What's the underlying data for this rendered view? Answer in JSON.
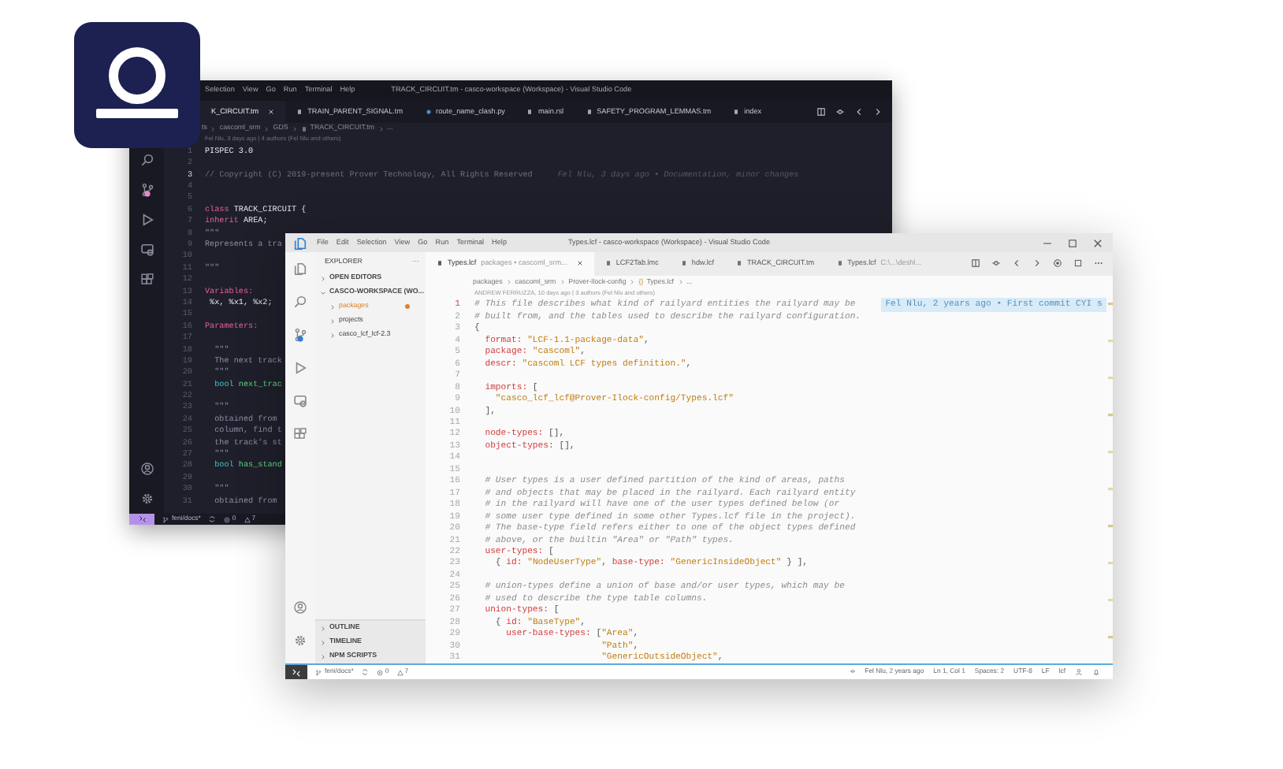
{
  "dark_window": {
    "menu": [
      "Selection",
      "View",
      "Go",
      "Run",
      "Terminal",
      "Help"
    ],
    "title": "TRACK_CIRCUIT.tm - casco-workspace (Workspace) - Visual Studio Code",
    "tabs": [
      {
        "label": "K_CIRCUIT.tm",
        "selected": true,
        "kind": "none"
      },
      {
        "label": "TRAIN_PARENT_SIGNAL.tm",
        "selected": false,
        "kind": "file"
      },
      {
        "label": "route_name_clash.py",
        "selected": false,
        "kind": "python"
      },
      {
        "label": "main.rsl",
        "selected": false,
        "kind": "file"
      },
      {
        "label": "SAFETY_PROGRAM_LEMMAS.tm",
        "selected": false,
        "kind": "file"
      },
      {
        "label": "index",
        "selected": false,
        "kind": "file"
      }
    ],
    "breadcrumb": [
      {
        "label": "ts",
        "kind": "none"
      },
      {
        "label": "cascoml_srm",
        "kind": "none"
      },
      {
        "label": "GDS",
        "kind": "none"
      },
      {
        "label": "TRACK_CIRCUIT.tm",
        "kind": "file"
      },
      {
        "label": "...",
        "kind": "none"
      }
    ],
    "blame_header": "Fel Nlu, 3 days ago | 4 authors (Fel Nlu and others)",
    "lines": [
      {
        "number": "1",
        "current": false,
        "segments": [
          {
            "text": "PISPEC 3.0",
            "kind": "ident"
          }
        ]
      },
      {
        "number": "2",
        "current": false
      },
      {
        "number": "3",
        "current": true,
        "segments": [
          {
            "text": "// Copyright (C) 2019-present Prover Technology, All Rights Reserved",
            "kind": "comment"
          }
        ],
        "blame": "Fel Nlu, 3 days ago • Documentation, minor changes"
      },
      {
        "number": "4",
        "current": false
      },
      {
        "number": "5",
        "current": false
      },
      {
        "number": "6",
        "current": false,
        "segments": [
          {
            "text": "class ",
            "kind": "kw"
          },
          {
            "text": "TRACK_CIRCUIT {",
            "kind": "ident"
          }
        ]
      },
      {
        "number": "7",
        "current": false,
        "segments": [
          {
            "text": "inherit ",
            "kind": "kw"
          },
          {
            "text": "AREA;",
            "kind": "ident"
          }
        ]
      },
      {
        "number": "8",
        "current": false,
        "segments": [
          {
            "text": "\"\"\"",
            "kind": "doc"
          }
        ]
      },
      {
        "number": "9",
        "current": false,
        "segments": [
          {
            "text": "Represents a tra",
            "kind": "doc"
          }
        ]
      },
      {
        "number": "10",
        "current": false
      },
      {
        "number": "11",
        "current": false,
        "segments": [
          {
            "text": "\"\"\"",
            "kind": "doc"
          }
        ]
      },
      {
        "number": "12",
        "current": false
      },
      {
        "number": "13",
        "current": false,
        "segments": [
          {
            "text": "Variables:",
            "kind": "kw"
          }
        ]
      },
      {
        "number": "14",
        "current": false,
        "segments": [
          {
            "text": " %x, %x1, %x2;",
            "kind": "ident"
          }
        ]
      },
      {
        "number": "15",
        "current": false
      },
      {
        "number": "16",
        "current": false,
        "segments": [
          {
            "text": "Parameters:",
            "kind": "kw"
          }
        ]
      },
      {
        "number": "17",
        "current": false
      },
      {
        "number": "18",
        "current": false,
        "segments": [
          {
            "text": "  \"\"\"",
            "kind": "doc"
          }
        ]
      },
      {
        "number": "19",
        "current": false,
        "segments": [
          {
            "text": "  The next track",
            "kind": "doc"
          }
        ]
      },
      {
        "number": "20",
        "current": false,
        "segments": [
          {
            "text": "  \"\"\"",
            "kind": "doc"
          }
        ]
      },
      {
        "number": "21",
        "current": false,
        "segments": [
          {
            "text": "  bool ",
            "kind": "type"
          },
          {
            "text": "next_trac",
            "kind": "name"
          }
        ]
      },
      {
        "number": "22",
        "current": false
      },
      {
        "number": "23",
        "current": false,
        "segments": [
          {
            "text": "  \"\"\"",
            "kind": "doc"
          }
        ]
      },
      {
        "number": "24",
        "current": false,
        "segments": [
          {
            "text": "  obtained from",
            "kind": "doc"
          }
        ]
      },
      {
        "number": "25",
        "current": false,
        "segments": [
          {
            "text": "  column, find t",
            "kind": "doc"
          }
        ]
      },
      {
        "number": "26",
        "current": false,
        "segments": [
          {
            "text": "  the track's st",
            "kind": "doc"
          }
        ]
      },
      {
        "number": "27",
        "current": false,
        "segments": [
          {
            "text": "  \"\"\"",
            "kind": "doc"
          }
        ]
      },
      {
        "number": "28",
        "current": false,
        "segments": [
          {
            "text": "  bool ",
            "kind": "type"
          },
          {
            "text": "has_stand",
            "kind": "name"
          }
        ]
      },
      {
        "number": "29",
        "current": false
      },
      {
        "number": "30",
        "current": false,
        "segments": [
          {
            "text": "  \"\"\"",
            "kind": "doc"
          }
        ]
      },
      {
        "number": "31",
        "current": false,
        "segments": [
          {
            "text": "  obtained from",
            "kind": "doc"
          }
        ]
      }
    ],
    "status_bar": {
      "branch": "feni/docs*",
      "errors": "0",
      "warnings": "7"
    }
  },
  "light_window": {
    "menu": [
      "File",
      "Edit",
      "Selection",
      "View",
      "Go",
      "Run",
      "Terminal",
      "Help"
    ],
    "title": "Types.lcf - casco-workspace (Workspace) - Visual Studio Code",
    "explorer": {
      "title": "EXPLORER",
      "more": "···",
      "sections": [
        {
          "label": "OPEN EDITORS",
          "expanded": false
        },
        {
          "label": "CASCO-WORKSPACE (WO...",
          "expanded": true,
          "children": [
            {
              "label": "packages",
              "expanded": false,
              "modified": true
            },
            {
              "label": "projects",
              "expanded": false,
              "modified": false
            },
            {
              "label": "casco_lcf_lcf-2.3",
              "expanded": false,
              "modified": false
            }
          ]
        }
      ],
      "panels": [
        {
          "label": "OUTLINE",
          "expanded": false
        },
        {
          "label": "TIMELINE",
          "expanded": false
        },
        {
          "label": "NPM SCRIPTS",
          "expanded": false
        }
      ]
    },
    "tabs": [
      {
        "label": "Types.lcf",
        "description": "packages • cascoml_srm...",
        "selected": true,
        "kind": "file"
      },
      {
        "label": "LCF2Tab.lmc",
        "selected": false,
        "kind": "file"
      },
      {
        "label": "hdw.lcf",
        "selected": false,
        "kind": "file"
      },
      {
        "label": "TRACK_CIRCUIT.tm",
        "selected": false,
        "kind": "file"
      },
      {
        "label": "Types.lcf",
        "description": "C:\\...\\deshl...",
        "selected": false,
        "kind": "file"
      }
    ],
    "breadcrumb": [
      {
        "label": "packages",
        "kind": "none"
      },
      {
        "label": "cascoml_srm",
        "kind": "none"
      },
      {
        "label": "Prover-Ilock-config",
        "kind": "none"
      },
      {
        "label": "Types.lcf",
        "kind": "braces",
        "icon": "{}"
      },
      {
        "label": "...",
        "kind": "none"
      }
    ],
    "blame_header": "ANDREW FERRUZZA, 10 days ago | 3 authors (Fel Nlu and others)",
    "lines": [
      {
        "number": "1",
        "current": true,
        "segments": [
          {
            "text": "# This file describes what kind of railyard entities the railyard may be",
            "kind": "comment"
          }
        ],
        "blame": "Fel Nlu, 2 years ago • First commit CYI s"
      },
      {
        "number": "2",
        "current": false,
        "segments": [
          {
            "text": "# built from, and the tables used to describe the railyard configuration.",
            "kind": "comment"
          }
        ]
      },
      {
        "number": "3",
        "current": false,
        "segments": [
          {
            "text": "{",
            "kind": "plain"
          }
        ]
      },
      {
        "number": "4",
        "current": false,
        "segments": [
          {
            "text": "  format:",
            "kind": "key"
          },
          {
            "text": " \"LCF-1.1-package-data\"",
            "kind": "string"
          },
          {
            "text": ",",
            "kind": "plain"
          }
        ]
      },
      {
        "number": "5",
        "current": false,
        "segments": [
          {
            "text": "  package:",
            "kind": "key"
          },
          {
            "text": " \"cascoml\"",
            "kind": "string"
          },
          {
            "text": ",",
            "kind": "plain"
          }
        ]
      },
      {
        "number": "6",
        "current": false,
        "segments": [
          {
            "text": "  descr:",
            "kind": "key"
          },
          {
            "text": " \"cascoml LCF types definition.\"",
            "kind": "string"
          },
          {
            "text": ",",
            "kind": "plain"
          }
        ]
      },
      {
        "number": "7",
        "current": false
      },
      {
        "number": "8",
        "current": false,
        "segments": [
          {
            "text": "  imports:",
            "kind": "key"
          },
          {
            "text": " [",
            "kind": "plain"
          }
        ]
      },
      {
        "number": "9",
        "current": false,
        "segments": [
          {
            "text": "    \"casco_lcf_lcf@Prover-Ilock-config/Types.lcf\"",
            "kind": "string"
          }
        ]
      },
      {
        "number": "10",
        "current": false,
        "segments": [
          {
            "text": "  ],",
            "kind": "plain"
          }
        ]
      },
      {
        "number": "11",
        "current": false
      },
      {
        "number": "12",
        "current": false,
        "segments": [
          {
            "text": "  node-types:",
            "kind": "key"
          },
          {
            "text": " [],",
            "kind": "plain"
          }
        ]
      },
      {
        "number": "13",
        "current": false,
        "segments": [
          {
            "text": "  object-types:",
            "kind": "key"
          },
          {
            "text": " [],",
            "kind": "plain"
          }
        ]
      },
      {
        "number": "14",
        "current": false
      },
      {
        "number": "15",
        "current": false
      },
      {
        "number": "16",
        "current": false,
        "segments": [
          {
            "text": "  # User types is a user defined partition of the kind of areas, paths",
            "kind": "comment"
          }
        ]
      },
      {
        "number": "17",
        "current": false,
        "segments": [
          {
            "text": "  # and objects that may be placed in the railyard. Each railyard entity",
            "kind": "comment"
          }
        ]
      },
      {
        "number": "18",
        "current": false,
        "segments": [
          {
            "text": "  # in the railyard will have one of the user types defined below (or",
            "kind": "comment"
          }
        ]
      },
      {
        "number": "19",
        "current": false,
        "segments": [
          {
            "text": "  # some user type defined in some other Types.lcf file in the project).",
            "kind": "comment"
          }
        ]
      },
      {
        "number": "20",
        "current": false,
        "segments": [
          {
            "text": "  # The base-type field refers either to one of the object types defined",
            "kind": "comment"
          }
        ]
      },
      {
        "number": "21",
        "current": false,
        "segments": [
          {
            "text": "  # above, or the builtin \"Area\" or \"Path\" types.",
            "kind": "comment"
          }
        ]
      },
      {
        "number": "22",
        "current": false,
        "segments": [
          {
            "text": "  user-types:",
            "kind": "key"
          },
          {
            "text": " [",
            "kind": "plain"
          }
        ]
      },
      {
        "number": "23",
        "current": false,
        "segments": [
          {
            "text": "    { ",
            "kind": "plain"
          },
          {
            "text": "id:",
            "kind": "key"
          },
          {
            "text": " \"NodeUserType\"",
            "kind": "string"
          },
          {
            "text": ", ",
            "kind": "plain"
          },
          {
            "text": "base-type:",
            "kind": "key"
          },
          {
            "text": " \"GenericInsideObject\"",
            "kind": "string"
          },
          {
            "text": " } ],",
            "kind": "plain"
          }
        ]
      },
      {
        "number": "24",
        "current": false
      },
      {
        "number": "25",
        "current": false,
        "segments": [
          {
            "text": "  # union-types define a union of base and/or user types, which may be",
            "kind": "comment"
          }
        ]
      },
      {
        "number": "26",
        "current": false,
        "segments": [
          {
            "text": "  # used to describe the type table columns.",
            "kind": "comment"
          }
        ]
      },
      {
        "number": "27",
        "current": false,
        "segments": [
          {
            "text": "  union-types:",
            "kind": "key"
          },
          {
            "text": " [",
            "kind": "plain"
          }
        ]
      },
      {
        "number": "28",
        "current": false,
        "segments": [
          {
            "text": "    { ",
            "kind": "plain"
          },
          {
            "text": "id:",
            "kind": "key"
          },
          {
            "text": " \"BaseType\"",
            "kind": "string"
          },
          {
            "text": ",",
            "kind": "plain"
          }
        ]
      },
      {
        "number": "29",
        "current": false,
        "segments": [
          {
            "text": "      user-base-types:",
            "kind": "key"
          },
          {
            "text": " [",
            "kind": "plain"
          },
          {
            "text": "\"Area\"",
            "kind": "string"
          },
          {
            "text": ",",
            "kind": "plain"
          }
        ]
      },
      {
        "number": "30",
        "current": false,
        "segments": [
          {
            "text": "                        \"Path\"",
            "kind": "string"
          },
          {
            "text": ",",
            "kind": "plain"
          }
        ]
      },
      {
        "number": "31",
        "current": false,
        "segments": [
          {
            "text": "                        \"GenericOutsideObject\"",
            "kind": "string"
          },
          {
            "text": ",",
            "kind": "plain"
          }
        ]
      }
    ],
    "status_bar": {
      "branch": "feni/docs*",
      "errors": "0",
      "warnings": "7",
      "items": [
        "Fel Nlu, 2 years ago",
        "Ln 1, Col 1",
        "Spaces: 2",
        "UTF-8",
        "LF",
        "lcf"
      ]
    }
  }
}
